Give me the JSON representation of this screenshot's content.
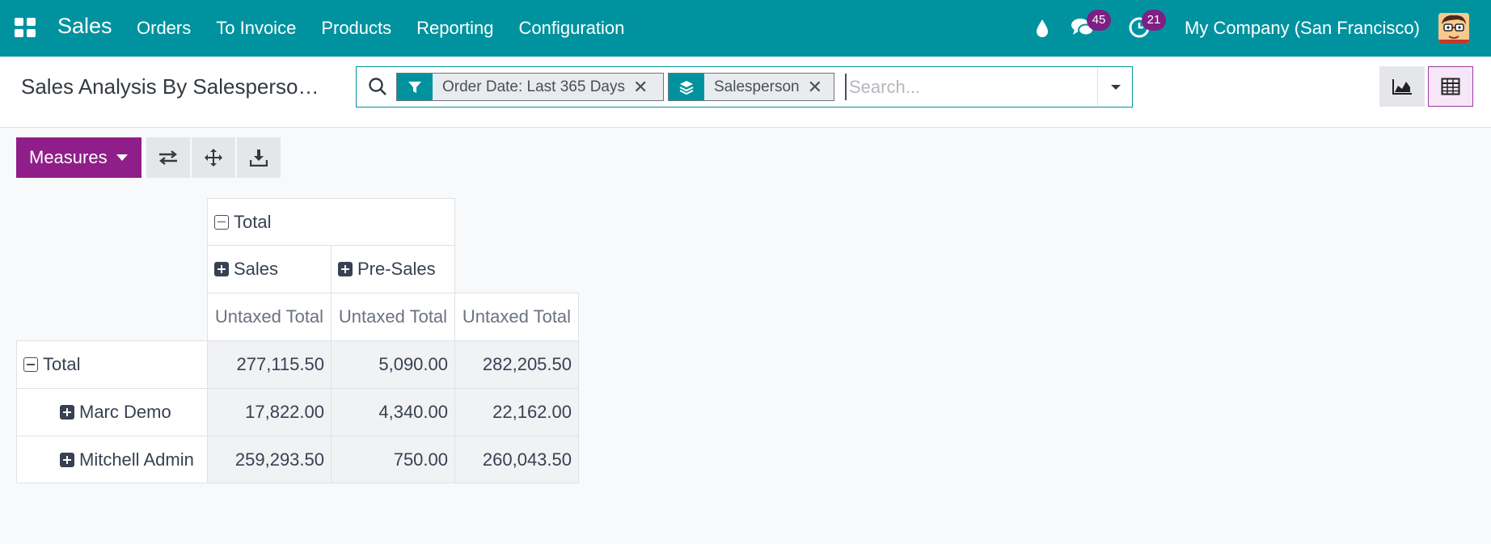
{
  "navbar": {
    "app_name": "Sales",
    "menu": [
      {
        "label": "Orders"
      },
      {
        "label": "To Invoice"
      },
      {
        "label": "Products"
      },
      {
        "label": "Reporting"
      },
      {
        "label": "Configuration"
      }
    ],
    "messages_count": "45",
    "activities_count": "21",
    "company": "My Company (San Francisco)"
  },
  "control": {
    "title": "Sales Analysis By Salesperso…",
    "search": {
      "placeholder": "Search...",
      "facets": [
        {
          "icon": "filter-icon",
          "label": "Order Date: Last 365 Days"
        },
        {
          "icon": "layers-icon",
          "label": "Salesperson"
        }
      ]
    },
    "views": [
      "graph-view",
      "pivot-view"
    ]
  },
  "toolbar": {
    "measures_label": "Measures"
  },
  "pivot": {
    "col_total": "Total",
    "col_groups": [
      "Sales",
      "Pre-Sales"
    ],
    "measure": "Untaxed Total",
    "rows": [
      {
        "label": "Total",
        "expanded": true,
        "values": [
          "277,115.50",
          "5,090.00",
          "282,205.50"
        ]
      },
      {
        "label": "Marc Demo",
        "expanded": false,
        "values": [
          "17,822.00",
          "4,340.00",
          "22,162.00"
        ]
      },
      {
        "label": "Mitchell Admin",
        "expanded": false,
        "values": [
          "259,293.50",
          "750.00",
          "260,043.50"
        ]
      }
    ]
  },
  "colors": {
    "navbar": "#00939f",
    "primary": "#8f1e8a",
    "badge": "#7e1f86"
  }
}
